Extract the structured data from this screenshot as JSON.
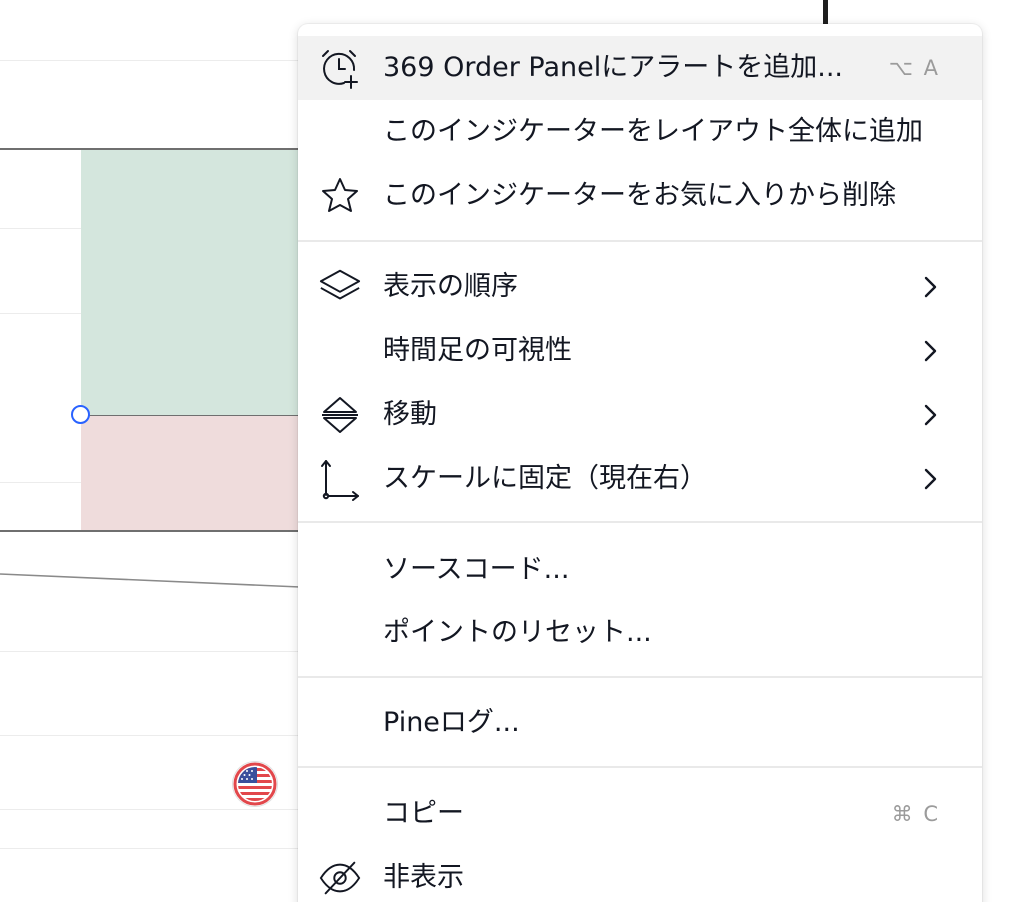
{
  "menu": {
    "items": [
      {
        "label": "369 Order Panelにアラートを追加...",
        "shortcut": "⌥ A",
        "icon": "alarm-add-icon"
      },
      {
        "label": "このインジケーターをレイアウト全体に追加"
      },
      {
        "label": "このインジケーターをお気に入りから削除",
        "icon": "star-icon"
      },
      {
        "label": "表示の順序",
        "icon": "layers-icon",
        "submenu": true
      },
      {
        "label": "時間足の可視性",
        "submenu": true
      },
      {
        "label": "移動",
        "icon": "move-icon",
        "submenu": true
      },
      {
        "label": "スケールに固定（現在右）",
        "icon": "scale-pin-icon",
        "submenu": true
      },
      {
        "label": "ソースコード..."
      },
      {
        "label": "ポイントのリセット..."
      },
      {
        "label": "Pineログ..."
      },
      {
        "label": "コピー",
        "shortcut": "⌘ C"
      },
      {
        "label": "非表示",
        "icon": "eye-hidden-icon"
      }
    ]
  },
  "colors": {
    "hover_bg": "#f2f2f2",
    "text": "#131722",
    "shortcut": "#9b9b9b",
    "profit_zone": "#d4e6dd",
    "loss_zone": "#efdcdc",
    "handle": "#2962ff"
  }
}
